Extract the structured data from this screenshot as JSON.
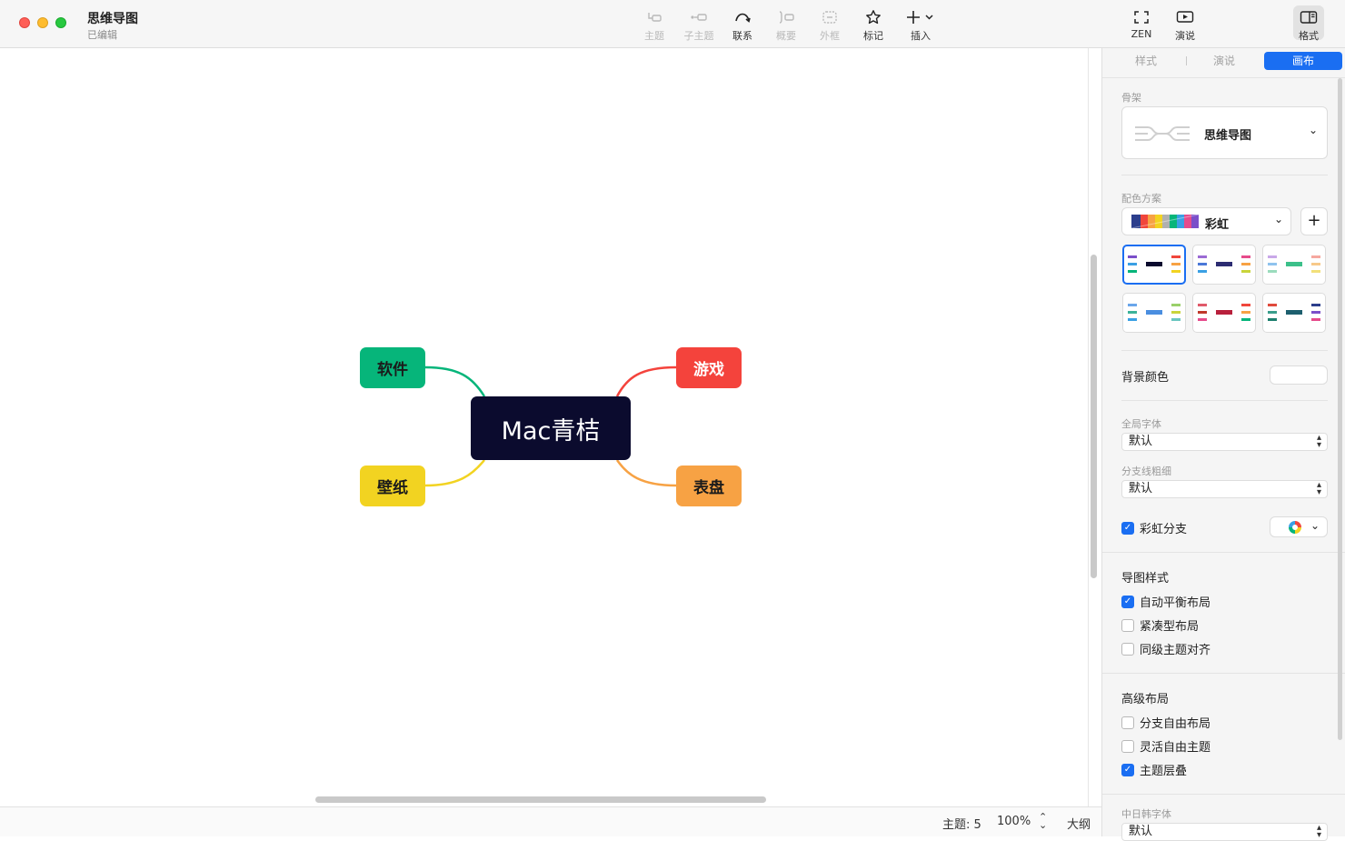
{
  "window": {
    "title": "思维导图",
    "subtitle": "已编辑"
  },
  "toolbar": {
    "items": [
      {
        "label": "主题",
        "icon": "topic-icon",
        "enabled": false
      },
      {
        "label": "子主题",
        "icon": "subtopic-icon",
        "enabled": false
      },
      {
        "label": "联系",
        "icon": "relationship-icon",
        "enabled": true
      },
      {
        "label": "概要",
        "icon": "summary-icon",
        "enabled": false
      },
      {
        "label": "外框",
        "icon": "boundary-icon",
        "enabled": false
      },
      {
        "label": "标记",
        "icon": "star-icon",
        "enabled": true
      },
      {
        "label": "插入",
        "icon": "plus-icon",
        "enabled": true
      }
    ],
    "right": [
      {
        "label": "ZEN",
        "icon": "fullscreen-icon"
      },
      {
        "label": "演说",
        "icon": "play-icon"
      },
      {
        "label": "格式",
        "icon": "sidebar-icon"
      }
    ]
  },
  "mindmap": {
    "central": "Mac青桔",
    "branches": [
      {
        "label": "软件",
        "color": "#06b57a"
      },
      {
        "label": "游戏",
        "color": "#f4433c"
      },
      {
        "label": "壁纸",
        "color": "#f2d321"
      },
      {
        "label": "表盘",
        "color": "#f7a244"
      }
    ]
  },
  "statusbar": {
    "topics": "主题: 5",
    "zoom": "100%",
    "outline": "大纲"
  },
  "panel": {
    "tabs": [
      {
        "label": "样式",
        "active": false
      },
      {
        "label": "演说",
        "active": false
      },
      {
        "label": "画布",
        "active": true
      }
    ],
    "skeleton": {
      "title": "骨架",
      "value": "思维导图"
    },
    "color_scheme": {
      "title": "配色方案",
      "value": "彩虹",
      "add": "+"
    },
    "background": {
      "label": "背景颜色",
      "color": "#ffffff"
    },
    "global_font": {
      "title": "全局字体",
      "value": "默认"
    },
    "branch_width": {
      "title": "分支线粗细",
      "value": "默认"
    },
    "rainbow_branch": {
      "label": "彩虹分支",
      "checked": true
    },
    "map_style": {
      "title": "导图样式",
      "options": [
        {
          "label": "自动平衡布局",
          "checked": true
        },
        {
          "label": "紧凑型布局",
          "checked": false
        },
        {
          "label": "同级主题对齐",
          "checked": false
        }
      ]
    },
    "advanced": {
      "title": "高级布局",
      "options": [
        {
          "label": "分支自由布局",
          "checked": false
        },
        {
          "label": "灵活自由主题",
          "checked": false
        },
        {
          "label": "主题层叠",
          "checked": true
        }
      ]
    },
    "cjk_font": {
      "title": "中日韩字体",
      "value": "默认"
    }
  }
}
